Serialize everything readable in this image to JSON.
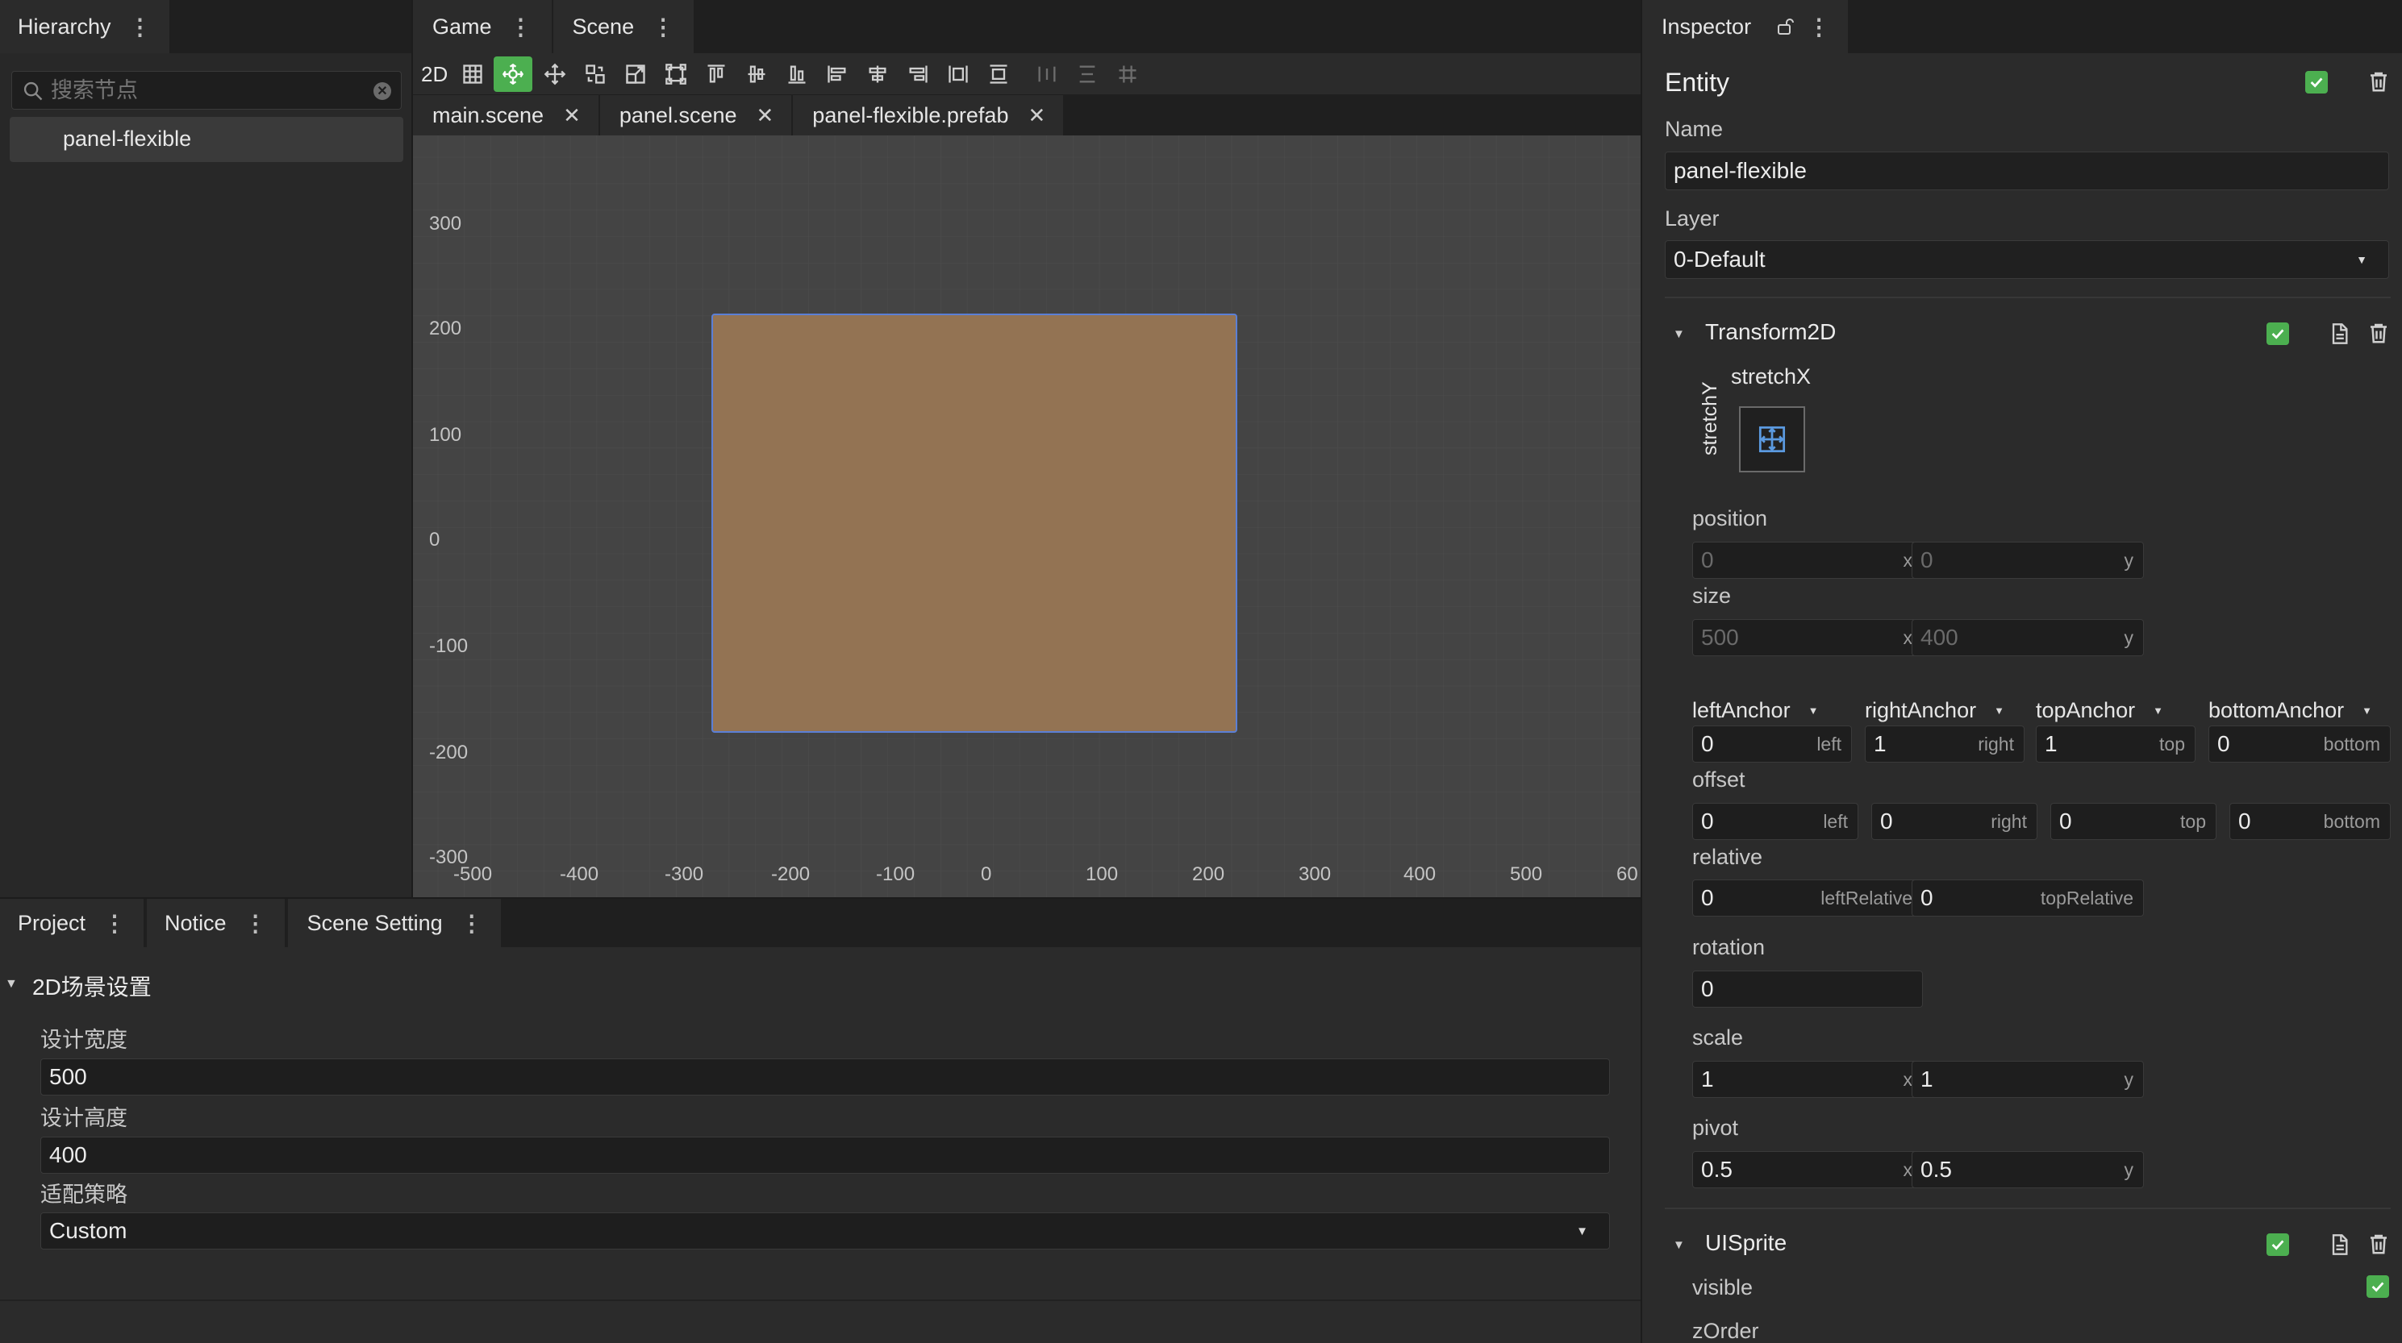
{
  "hierarchy": {
    "tab": "Hierarchy",
    "search_placeholder": "搜索节点",
    "items": [
      "panel-flexible"
    ]
  },
  "center": {
    "tabs": [
      "Game",
      "Scene"
    ],
    "toolbar_2d": "2D",
    "file_tabs": [
      "main.scene",
      "panel.scene",
      "panel-flexible.prefab"
    ]
  },
  "scene_view": {
    "y_labels": [
      "300",
      "200",
      "100",
      "0",
      "-100",
      "-200",
      "-300"
    ],
    "x_labels": [
      "-500",
      "-400",
      "-300",
      "-200",
      "-100",
      "0",
      "100",
      "200",
      "300",
      "400",
      "500",
      "60"
    ],
    "panel_color": "#937353"
  },
  "bottom": {
    "tabs": [
      "Project",
      "Notice",
      "Scene Setting"
    ],
    "section": "2D场景设置",
    "width_label": "设计宽度",
    "width_value": "500",
    "height_label": "设计高度",
    "height_value": "400",
    "strategy_label": "适配策略",
    "strategy_value": "Custom"
  },
  "inspector": {
    "tab": "Inspector",
    "entity_title": "Entity",
    "name_label": "Name",
    "name_value": "panel-flexible",
    "layer_label": "Layer",
    "layer_value": "0-Default",
    "transform": {
      "title": "Transform2D",
      "stretch_x": "stretchX",
      "stretch_y": "stretchY",
      "position_label": "position",
      "position_x": "0",
      "position_y": "0",
      "size_label": "size",
      "size_x": "500",
      "size_y": "400",
      "x": "x",
      "y": "y",
      "anchor_labels": [
        "leftAnchor",
        "rightAnchor",
        "topAnchor",
        "bottomAnchor"
      ],
      "anchor_values": [
        "0",
        "1",
        "1",
        "0"
      ],
      "anchor_suffixes": [
        "left",
        "right",
        "top",
        "bottom"
      ],
      "offset_label": "offset",
      "offset_values": [
        "0",
        "0",
        "0",
        "0"
      ],
      "offset_suffixes": [
        "left",
        "right",
        "top",
        "bottom"
      ],
      "relative_label": "relative",
      "relative_values": [
        "0",
        "0"
      ],
      "relative_suffixes": [
        "leftRelative",
        "topRelative"
      ],
      "rotation_label": "rotation",
      "rotation_value": "0",
      "scale_label": "scale",
      "scale_x": "1",
      "scale_y": "1",
      "pivot_label": "pivot",
      "pivot_x": "0.5",
      "pivot_y": "0.5"
    },
    "uisprite": {
      "title": "UISprite",
      "visible_label": "visible",
      "zorder_label": "zOrder"
    }
  },
  "colors": {
    "accent_green": "#4caf50",
    "selection_blue": "#5b7fd6"
  }
}
